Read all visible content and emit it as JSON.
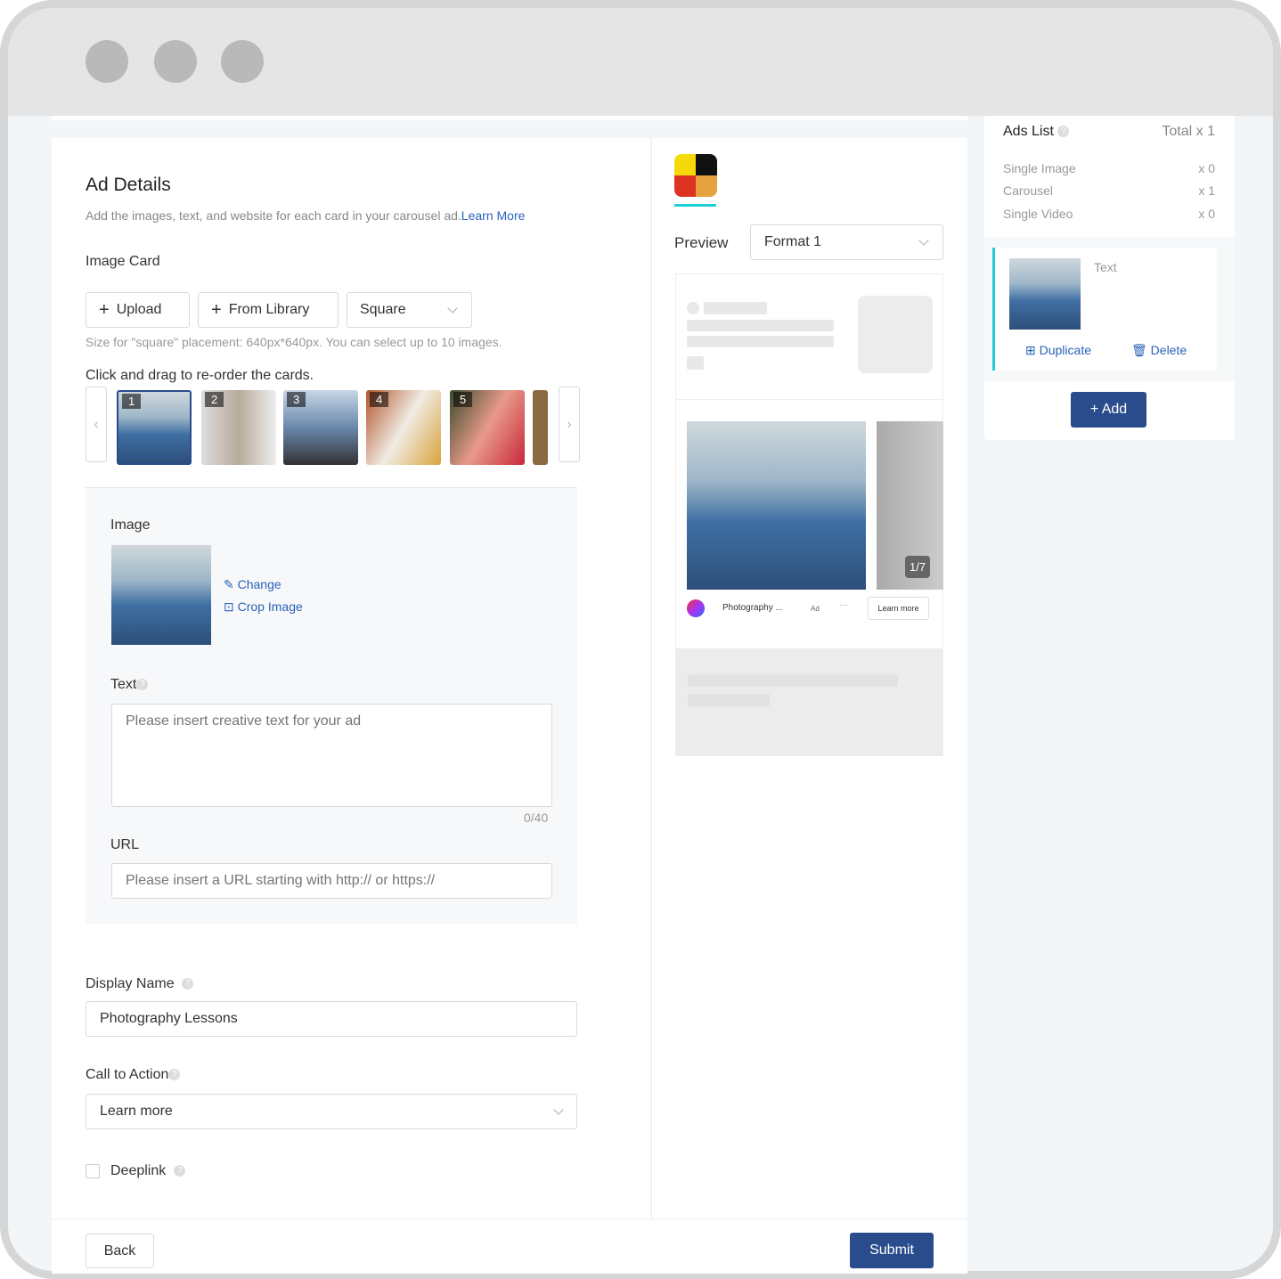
{
  "window": {
    "controls": [
      "close",
      "minimize",
      "maximize"
    ]
  },
  "ad_details": {
    "title": "Ad Details",
    "subtitle": "Add the images, text, and website for each card in your carousel ad.",
    "learn_more": "Learn More",
    "image_card_label": "Image Card",
    "upload_label": "Upload",
    "library_label": "From Library",
    "shape_select": "Square",
    "size_hint": "Size for \"square\" placement: 640px*640px. You can select up to 10 images.",
    "reorder_hint": "Click and drag to re-order the cards.",
    "cards": [
      "1",
      "2",
      "3",
      "4",
      "5"
    ],
    "image_label": "Image",
    "change_label": "Change",
    "crop_label": "Crop Image",
    "text_label": "Text",
    "text_placeholder": "Please insert creative text for your ad",
    "text_count": "0/40",
    "url_label": "URL",
    "url_placeholder": "Please insert a URL starting with http:// or https://",
    "display_name_label": "Display Name",
    "display_name_value": "Photography Lessons",
    "cta_label": "Call to Action",
    "cta_value": "Learn more",
    "deeplink_label": "Deeplink",
    "deeplink_checked": false
  },
  "preview": {
    "label": "Preview",
    "format_value": "Format 1",
    "counter": "1/7",
    "advertiser": "Photography ...",
    "ad_badge": "Ad",
    "more": "···",
    "cta": "Learn more"
  },
  "ads_list": {
    "title": "Ads List",
    "total": "Total x 1",
    "rows": [
      {
        "label": "Single Image",
        "count": "x 0"
      },
      {
        "label": "Carousel",
        "count": "x 1"
      },
      {
        "label": "Single Video",
        "count": "x 0"
      }
    ],
    "item_text": "Text",
    "duplicate": "Duplicate",
    "delete": "Delete",
    "add": "+ Add"
  },
  "footer": {
    "back": "Back",
    "submit": "Submit"
  },
  "colors": {
    "primary": "#2b4c8c",
    "link": "#2a62b8",
    "accent": "#1fcfd6"
  }
}
